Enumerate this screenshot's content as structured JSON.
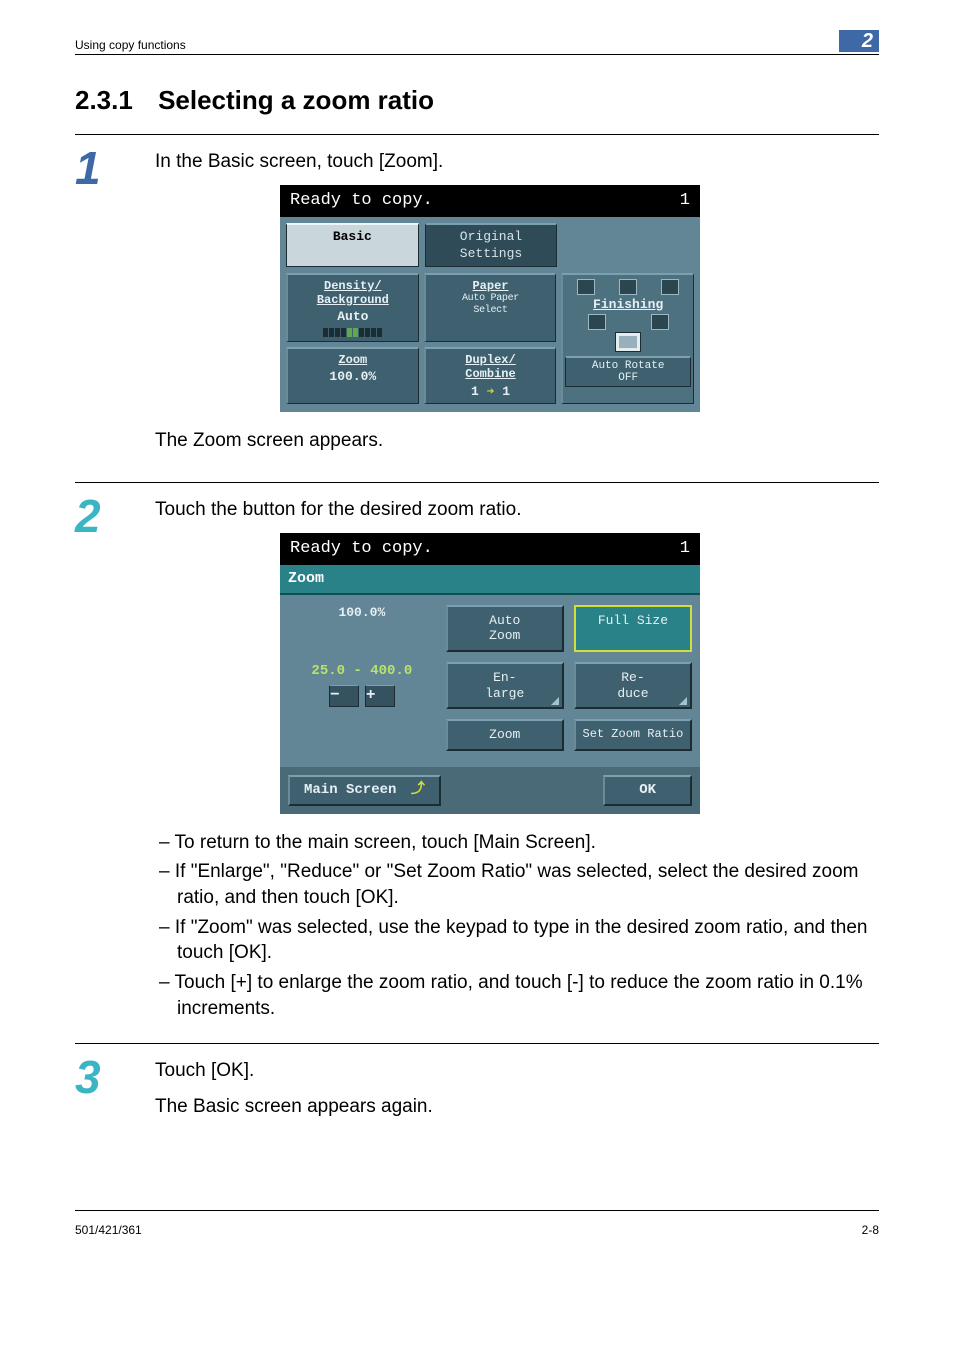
{
  "header": {
    "section": "Using copy functions",
    "chapter": "2"
  },
  "heading": {
    "number": "2.3.1",
    "title": "Selecting a zoom ratio"
  },
  "step1": {
    "num": "1",
    "text": "In the Basic screen, touch [Zoom].",
    "after": "The Zoom screen appears.",
    "screen": {
      "status": "Ready to copy.",
      "count": "1",
      "tab_basic": "Basic",
      "tab_original": "Original\nSettings",
      "density_label": "Density/\nBackground",
      "density_value": "Auto",
      "paper_label": "Paper",
      "paper_value": "Auto Paper\nSelect",
      "finishing_label": "Finishing",
      "zoom_label": "Zoom",
      "zoom_value": "100.0%",
      "duplex_label": "Duplex/\nCombine",
      "duplex_value_left": "1",
      "duplex_value_right": "1",
      "autorotate": "Auto Rotate\nOFF"
    }
  },
  "step2": {
    "num": "2",
    "text": "Touch the button for the desired zoom ratio.",
    "screen": {
      "status": "Ready to copy.",
      "count": "1",
      "title": "Zoom",
      "current": "100.0%",
      "autozoom": "Auto\nZoom",
      "fullsize": "Full Size",
      "range": "25.0  -  400.0",
      "minus": "−",
      "plus": "+",
      "enlarge": "En-\nlarge",
      "reduce": "Re-\nduce",
      "zoom": "Zoom",
      "setzoom": "Set Zoom Ratio",
      "mainscreen": "Main Screen",
      "ok": "OK"
    },
    "bullets": [
      "To return to the main screen, touch [Main Screen].",
      "If \"Enlarge\", \"Reduce\" or \"Set Zoom Ratio\" was selected, select the desired zoom ratio, and then touch [OK].",
      "If \"Zoom\" was selected, use the keypad to type in the desired zoom ratio, and then touch [OK].",
      "Touch [+] to enlarge the zoom ratio, and touch [-] to reduce the zoom ratio in 0.1% increments."
    ]
  },
  "step3": {
    "num": "3",
    "text": "Touch [OK].",
    "after": "The Basic screen appears again."
  },
  "footer": {
    "left": "501/421/361",
    "right": "2-8"
  }
}
